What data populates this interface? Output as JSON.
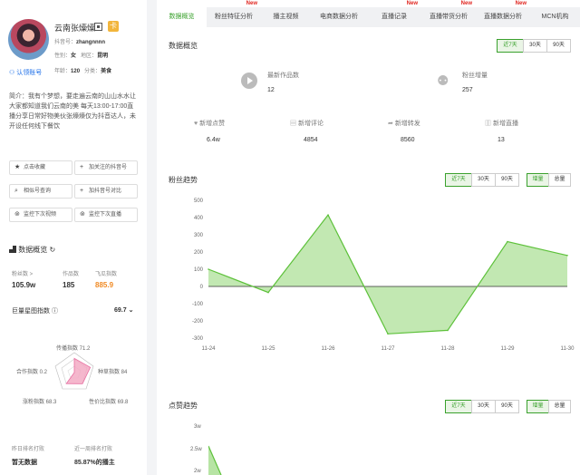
{
  "profile": {
    "name": "云南张燺燺",
    "douyin_id_label": "抖音号：",
    "douyin_id": "zhangnnnn",
    "gender_label": "性别：",
    "gender": "女",
    "region_label": "地区：",
    "region": "昆明",
    "age_label": "年龄：",
    "age": "120",
    "category_label": "分类：",
    "category": "美食",
    "verify_label": "认领账号",
    "intro": "简介：我有个梦想，要走遍云南的山山水水让大家都知道我们云南的美 每天13:00-17:00直播分享日常好物美伙张燺燺仅为抖音达人，未开设任何线下餐饮"
  },
  "actions": [
    {
      "label": "点击收藏",
      "icon": "star-icon"
    },
    {
      "label": "加关注的抖音号",
      "icon": "plus-icon"
    },
    {
      "label": "相似号查询",
      "icon": "search-icon"
    },
    {
      "label": "加抖音号对比",
      "icon": "plus-icon"
    },
    {
      "label": "监控下次视频",
      "icon": "monitor-icon"
    },
    {
      "label": "监控下次直播",
      "icon": "monitor-icon"
    }
  ],
  "overview": {
    "title": "数据概览",
    "fans_label": "粉丝数 >",
    "fans": "105.9w",
    "works_label": "作品数",
    "works": "185",
    "index_label": "飞瓜指数",
    "index": "885.9",
    "quality_label": "巨量星图指数",
    "quality": "69.7"
  },
  "radar": {
    "labels": [
      "传播指数 71.2",
      "种草指数 84",
      "性价比指数 69.8",
      "涨粉指数 68.3",
      "合作指数 0.2"
    ],
    "values": [
      71.2,
      84,
      69.8,
      68.3,
      0.2
    ]
  },
  "ranking": {
    "col1_label": "昨日排名打败",
    "col1_value": "暂无数据",
    "col2_label": "近一周排名打败",
    "col2_value": "85.87%的播主"
  },
  "tabs": [
    {
      "label": "数据概览",
      "new": ""
    },
    {
      "label": "粉丝特征分析",
      "new": "New"
    },
    {
      "label": "播主视频",
      "new": ""
    },
    {
      "label": "电商数据分析",
      "new": ""
    },
    {
      "label": "直播记录",
      "new": "New"
    },
    {
      "label": "直播带货分析",
      "new": "New"
    },
    {
      "label": "直播数据分析",
      "new": "New"
    },
    {
      "label": "MCN机构",
      "new": ""
    }
  ],
  "summary": {
    "title": "数据概览",
    "range_options": [
      "近7天",
      "30天",
      "90天"
    ],
    "latest_works_label": "最新作品数",
    "latest_works": "12",
    "fans_growth_label": "粉丝增量",
    "fans_growth": "257",
    "likes_label": "新增点赞",
    "likes": "6.4w",
    "comments_label": "新增评论",
    "comments": "4854",
    "shares_label": "新增转发",
    "shares": "8560",
    "lives_label": "新增直播",
    "lives": "13"
  },
  "fans_trend": {
    "title": "粉丝趋势",
    "range_options": [
      "近7天",
      "30天",
      "90天"
    ],
    "mode_options": [
      "增量",
      "总量"
    ]
  },
  "likes_trend": {
    "title": "点赞趋势",
    "range_options": [
      "近7天",
      "30天",
      "90天"
    ],
    "mode_options": [
      "增量",
      "总量"
    ],
    "visible_ticks": [
      "3w",
      "2.5w",
      "2w"
    ]
  },
  "chart_data": {
    "type": "area",
    "title": "粉丝趋势",
    "categories": [
      "11-24",
      "11-25",
      "11-26",
      "11-27",
      "11-28",
      "11-29",
      "11-30"
    ],
    "series": [
      {
        "values": [
          100,
          -35,
          415,
          -275,
          -255,
          260,
          180
        ]
      }
    ],
    "ylim": [
      -300,
      500
    ],
    "yticks": [
      500,
      400,
      300,
      200,
      100,
      0,
      -100,
      -200,
      -300
    ],
    "grid": false,
    "colors": {
      "line": "#5dc13a",
      "fill": "#b7e4a4"
    }
  }
}
